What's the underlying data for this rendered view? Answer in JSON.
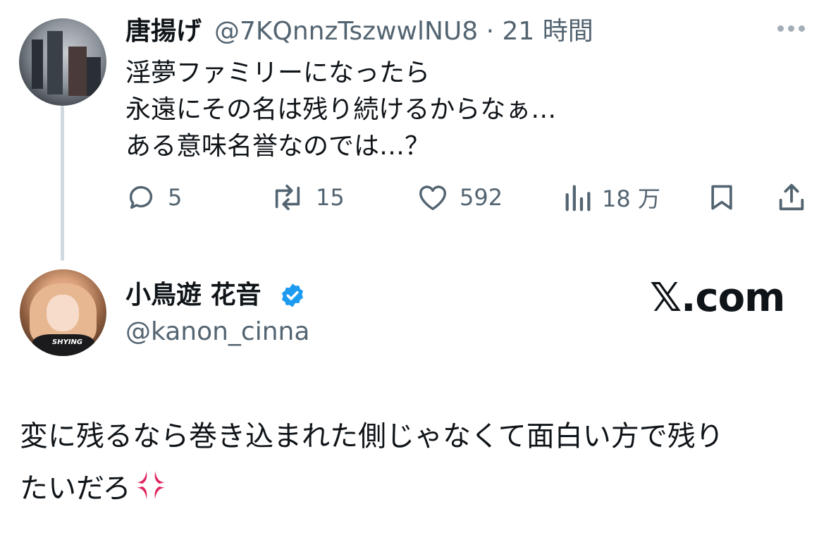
{
  "tweet1": {
    "display_name": "唐揚げ",
    "handle_time": "@7KQnnzTszwwlNU8 · 21 時間",
    "lines": [
      "淫夢ファミリーになったら",
      "永遠にその名は残り続けるからなぁ…",
      "ある意味名誉なのでは…？"
    ],
    "actions": {
      "reply_count": "5",
      "retweet_count": "15",
      "like_count": "592",
      "views_count": "18 万"
    }
  },
  "tweet2": {
    "display_name": "小鳥遊 花音",
    "handle": "@kanon_cinna",
    "lines": [
      "変に残るなら巻き込まれた側じゃなくて面白い方で残り",
      "たいだろ"
    ],
    "avatar_shirt_text": "SHYING"
  },
  "brand": "𝕏.com",
  "colors": {
    "text": "#0f1419",
    "secondary": "#536471",
    "thread_line": "#cfd9de",
    "verified": "#1d9bf0",
    "anger": "#e0245e"
  },
  "icons": [
    "reply-icon",
    "retweet-icon",
    "like-icon",
    "views-icon",
    "bookmark-icon",
    "share-icon",
    "verified-badge-icon",
    "anger-emoji-icon",
    "more-icon"
  ]
}
